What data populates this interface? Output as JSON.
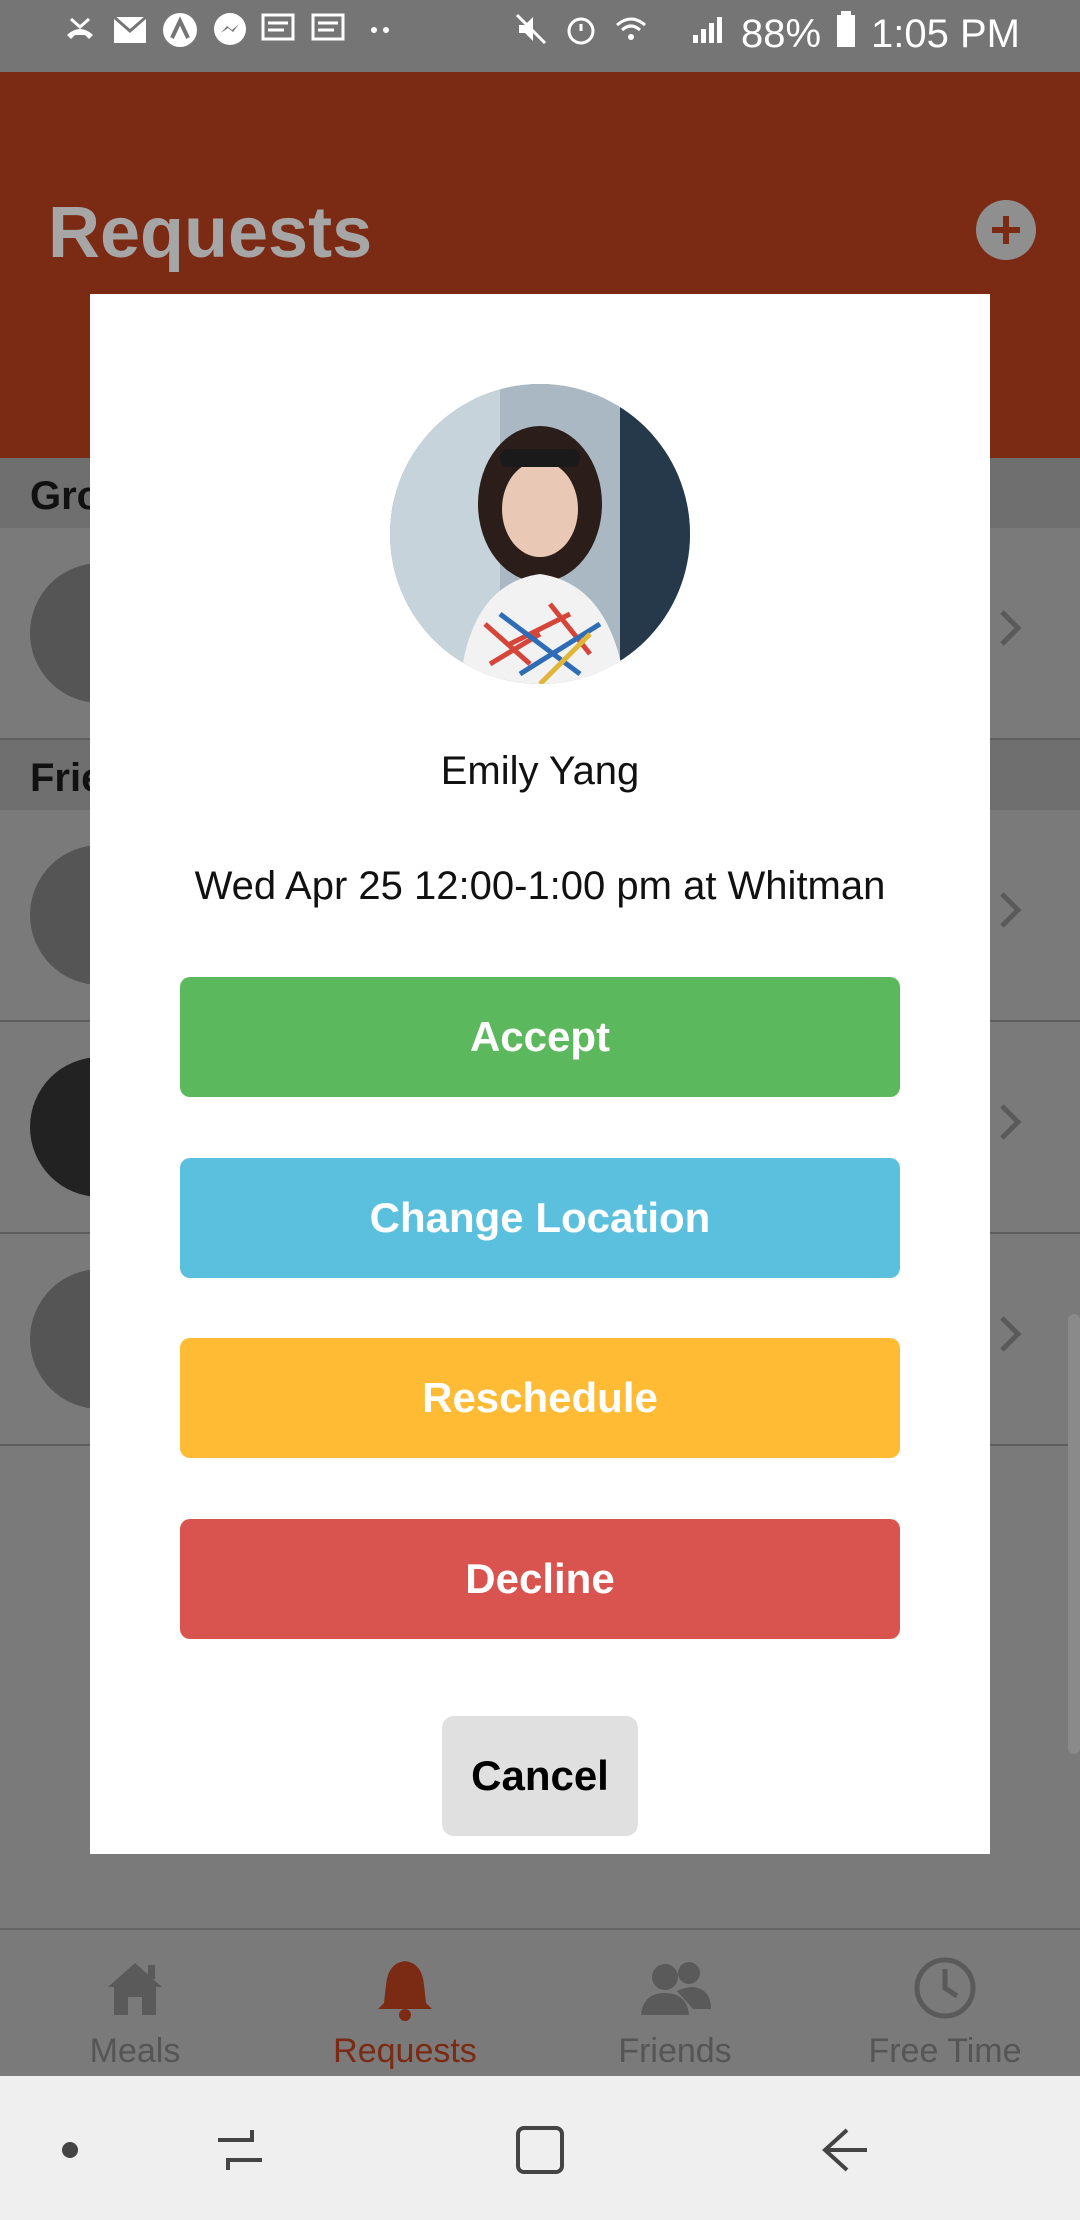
{
  "status": {
    "battery": "88%",
    "time": "1:05 PM"
  },
  "header": {
    "title": "Requests"
  },
  "sections": [
    {
      "label": "Gro"
    },
    {
      "label": "Frie"
    }
  ],
  "modal": {
    "name": "Emily Yang",
    "details": "Wed Apr 25 12:00-1:00 pm at Whitman",
    "buttons": {
      "accept": "Accept",
      "change_location": "Change Location",
      "reschedule": "Reschedule",
      "decline": "Decline",
      "cancel": "Cancel"
    },
    "colors": {
      "accept": "#5cb85c",
      "change_location": "#5bc0de",
      "reschedule": "#ffbb33",
      "decline": "#d9534f"
    }
  },
  "tabs": [
    {
      "label": "Meals",
      "icon": "home-icon"
    },
    {
      "label": "Requests",
      "icon": "bell-icon",
      "active": true
    },
    {
      "label": "Friends",
      "icon": "friends-icon"
    },
    {
      "label": "Free Time",
      "icon": "clock-icon"
    }
  ],
  "colors": {
    "header": "#7b2a13",
    "accent": "#7b2a13"
  }
}
